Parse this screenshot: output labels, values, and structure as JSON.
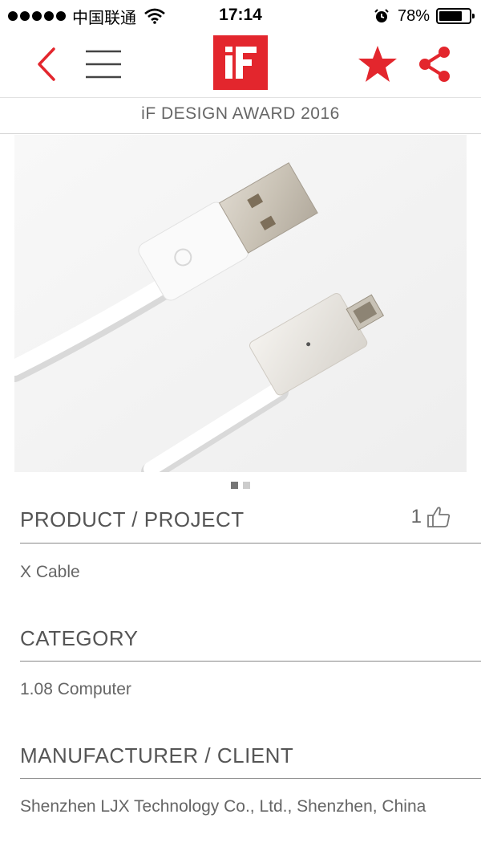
{
  "status_bar": {
    "carrier": "中国联通",
    "time": "17:14",
    "battery": "78%",
    "battery_level": 0.78
  },
  "nav": {
    "logo_text": "iF",
    "icons": [
      "back-chevron-icon",
      "hamburger-menu-icon",
      "star-icon",
      "share-icon"
    ],
    "accent_color": "#e3262d"
  },
  "award_title": "iF DESIGN AWARD 2016",
  "carousel": {
    "total": 2,
    "active_index": 0
  },
  "product": {
    "heading": "PRODUCT / PROJECT",
    "value": "X Cable",
    "likes": "1"
  },
  "category": {
    "heading": "CATEGORY",
    "value": "1.08 Computer"
  },
  "manufacturer": {
    "heading": "MANUFACTURER / CLIENT",
    "value": "Shenzhen LJX Technology Co., Ltd., Shenzhen, China"
  }
}
